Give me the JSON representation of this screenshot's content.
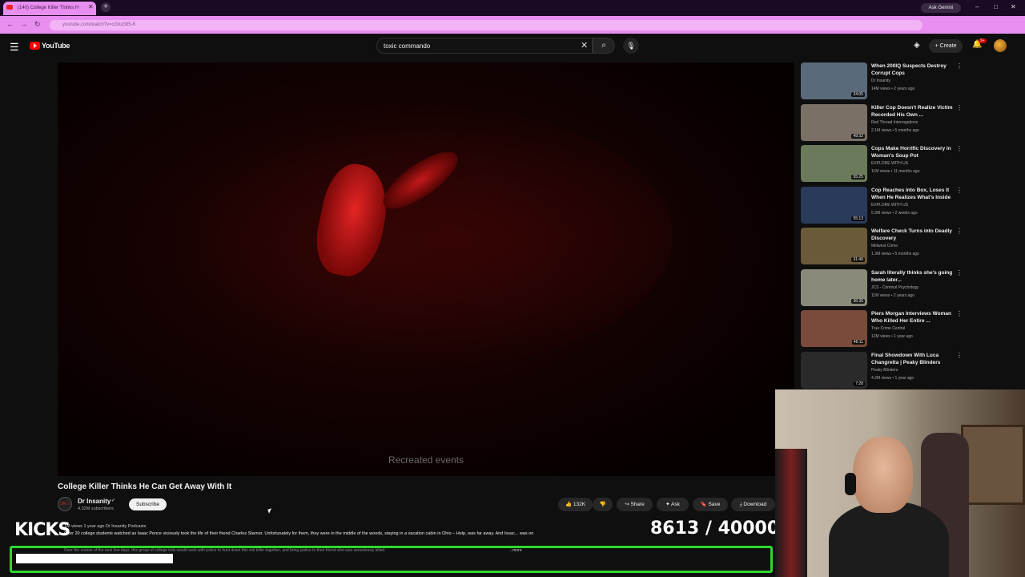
{
  "browser": {
    "tab_title": "(140) College Killer Thinks H",
    "url": "youtube.com/watch?v=cGIuG85-K",
    "ask_gemini": "Ask Gemini"
  },
  "header": {
    "logo_text": "YouTube",
    "search_value": "toxic commando",
    "create_label": "Create",
    "notifications_badge": "9+"
  },
  "player": {
    "overlay_text": "Recreated events"
  },
  "video": {
    "title": "College Killer Thinks He Can Get Away With It",
    "channel_name": "Dr Insanity",
    "channel_avatar_text": "DR. I",
    "subscribers": "4.32M subscribers",
    "subscribe_label": "Subscribe",
    "like_count": "132K",
    "share_label": "Share",
    "ask_label": "Ask",
    "save_label": "Save",
    "download_label": "Download"
  },
  "description": {
    "meta": "1M views  1 year ago  Dr Insanity Podcasts",
    "line1": "Over 20 college students watched as Isaac Pence viciously took the life of their friend Charles Starner. Unfortunately for them, they were in the middle of the woods, staying in a vacation cabin in Ohio – Help, was far away. And Issac... was on",
    "line2": "Over the course of the next few days, this group of college kids would work with police to hunt down this evil killer together, and bring justice to their friend who was senselessly killed.",
    "more_label": "...more"
  },
  "overlays": {
    "kicks": "KICKS",
    "counter": "8613 / 40000"
  },
  "recommendations": [
    {
      "title": "When 200IQ Suspects Destroy Corrupt Cops",
      "channel": "Dr Insanity",
      "views": "14M views • 2 years ago",
      "duration": "24:05",
      "thumb_color": "#5a6a7a"
    },
    {
      "title": "Killer Cop Doesn't Realize Victim Recorded His Own ...",
      "channel": "Red Thread Interrogations",
      "views": "2.1M views • 5 months ago",
      "duration": "49:32",
      "thumb_color": "#7a7066"
    },
    {
      "title": "Cops Make Horrific Discovery in Woman's Soup Pot",
      "channel": "EXPLORE WITH US",
      "views": "11M views • 11 months ago",
      "duration": "55:25",
      "thumb_color": "#6a7a5a"
    },
    {
      "title": "Cop Reaches into Box, Loses It When He Realizes What's Inside",
      "channel": "EXPLORE WITH US",
      "views": "5.3M views • 2 weeks ago",
      "duration": "55:13",
      "thumb_color": "#2a3a5a"
    },
    {
      "title": "Welfare Check Turns into Deadly Discovery",
      "channel": "Midwest Crime",
      "views": "1.3M views • 5 months ago",
      "duration": "31:40",
      "thumb_color": "#6a5a3a"
    },
    {
      "title": "Sarah literally thinks she's going home later...",
      "channel": "JCS - Criminal Psychology",
      "views": "11M views • 2 years ago",
      "duration": "36:36",
      "thumb_color": "#8a8a7a"
    },
    {
      "title": "Piers Morgan Interviews Woman Who Killed Her Entire ...",
      "channel": "True Crime Central",
      "views": "12M views • 1 year ago",
      "duration": "46:11",
      "thumb_color": "#7a4a3a"
    },
    {
      "title": "Final Showdown With Luca Changretta | Peaky Blinders",
      "channel": "Peaky Blinders",
      "views": "4.2M views • 1 year ago",
      "duration": "7:28",
      "thumb_color": "#2a2a2a"
    }
  ]
}
